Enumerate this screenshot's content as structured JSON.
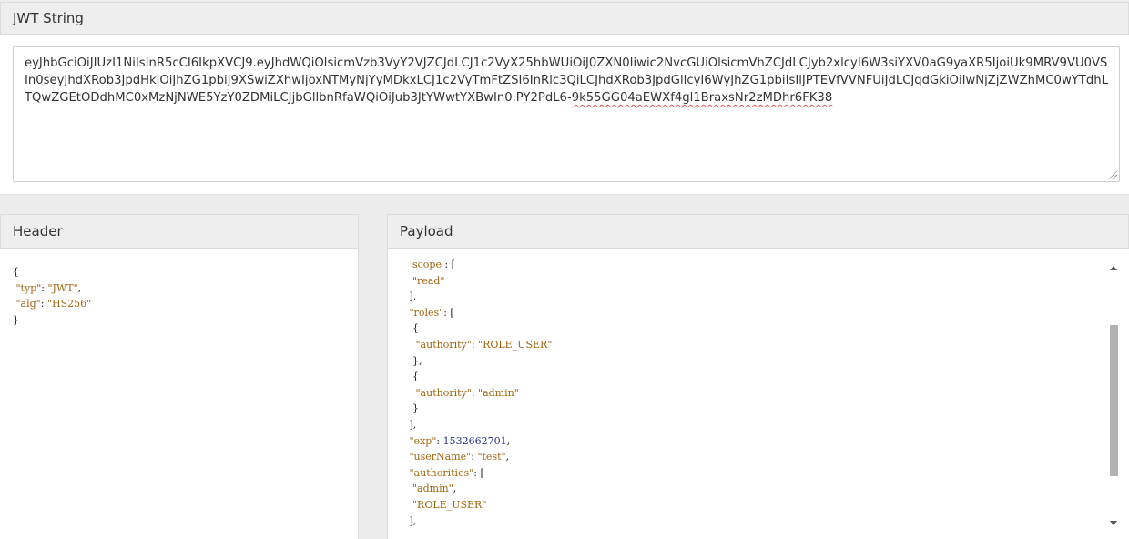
{
  "jwt": {
    "title": "JWT String",
    "token_plain": "eyJhbGciOiJIUzI1NiIsInR5cCI6IkpXVCJ9.eyJhdWQiOlsicmVzb3VyY2VJZCJdLCJ1c2VyX25hbWUiOiJ0ZXN0Iiwic2NvcGUiOlsicmVhZCJdLCJyb2xlcyI6W3siYXV0aG9yaXR5IjoiUk9MRV9VU0VSIn0seyJhdXRob3JpdHkiOiJhZG1pbiJ9XSwiZXhwIjoxNTMyNjYyMDkxLCJ1c2VyTmFtZSI6InRlc3QiLCJhdXRob3JpdGllcyI6WyJhZG1pbiIsIlJPTEVfVVNFUiJdLCJqdGkiOiIwNjZjZWZhMC0wYTdhLTQwZGEtODdhMC0xMzNjNWE5YzY0ZDMiLCJjbGllbnRfaWQiOiJub3JtYWwtYXBwIn0.PY2PdL6-",
    "token_misspelled": "9k55GG04aEWXf4gl1BraxsNr2zMDhr6FK38"
  },
  "header": {
    "title": "Header",
    "code": {
      "open": "{",
      "typ_key": "\"typ\"",
      "typ_val": "\"JWT\"",
      "alg_key": "\"alg\"",
      "alg_val": "\"HS256\"",
      "close": "}"
    }
  },
  "payload": {
    "title": "Payload",
    "code": {
      "scope_key": "scope",
      "scope_tail": " : [",
      "read": "\"read\"",
      "roles_key": "\"roles\"",
      "authority_key": "\"authority\"",
      "role_user": "\"ROLE_USER\"",
      "admin": "\"admin\"",
      "exp_key": "\"exp\"",
      "exp_val": "1532662701",
      "username_key": "\"userName\"",
      "username_val": "\"test\"",
      "authorities_key": "\"authorities\""
    }
  },
  "colors": {
    "code_key": "#a4640c",
    "code_number": "#27328f",
    "panel_head_bg": "#eeeeee",
    "spellcheck_underline": "#e25b5b"
  },
  "icons": [
    "resize-grip-icon",
    "scroll-up-arrow-icon",
    "scroll-down-arrow-icon"
  ]
}
